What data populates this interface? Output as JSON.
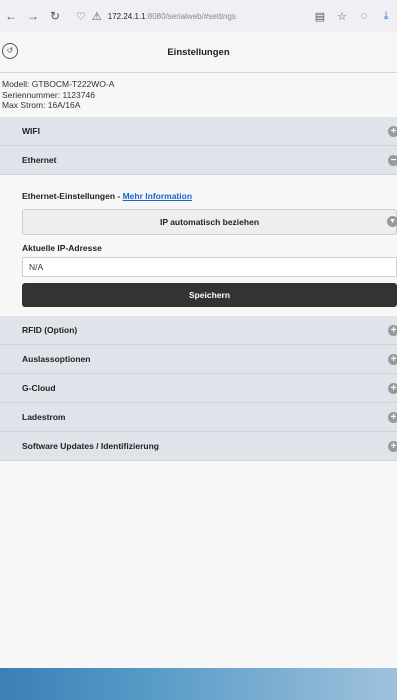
{
  "browser": {
    "url_host": "172.24.1.1",
    "url_rest": ":8080/serialweb/#settings"
  },
  "header": {
    "title": "Einstellungen"
  },
  "device": {
    "model": "Modell: GTBOCM-T222WO-A",
    "serial": "Seriennummer: 1123746",
    "max_current": "Max Strom: 16A/16A"
  },
  "sections": {
    "wifi": "WIFI",
    "ethernet": "Ethernet",
    "rfid": "RFID (Option)",
    "trigger": "Auslassoptionen",
    "gcloud": "G-Cloud",
    "charge": "Ladestrom",
    "software": "Software Updates / Identifizierung"
  },
  "ethernet_panel": {
    "title": "Ethernet-Einstellungen - ",
    "more_info": "Mehr Information",
    "ip_mode": "IP automatisch beziehen",
    "ip_label": "Aktuelle IP-Adresse",
    "ip_value": "N/A",
    "save": "Speichern"
  }
}
